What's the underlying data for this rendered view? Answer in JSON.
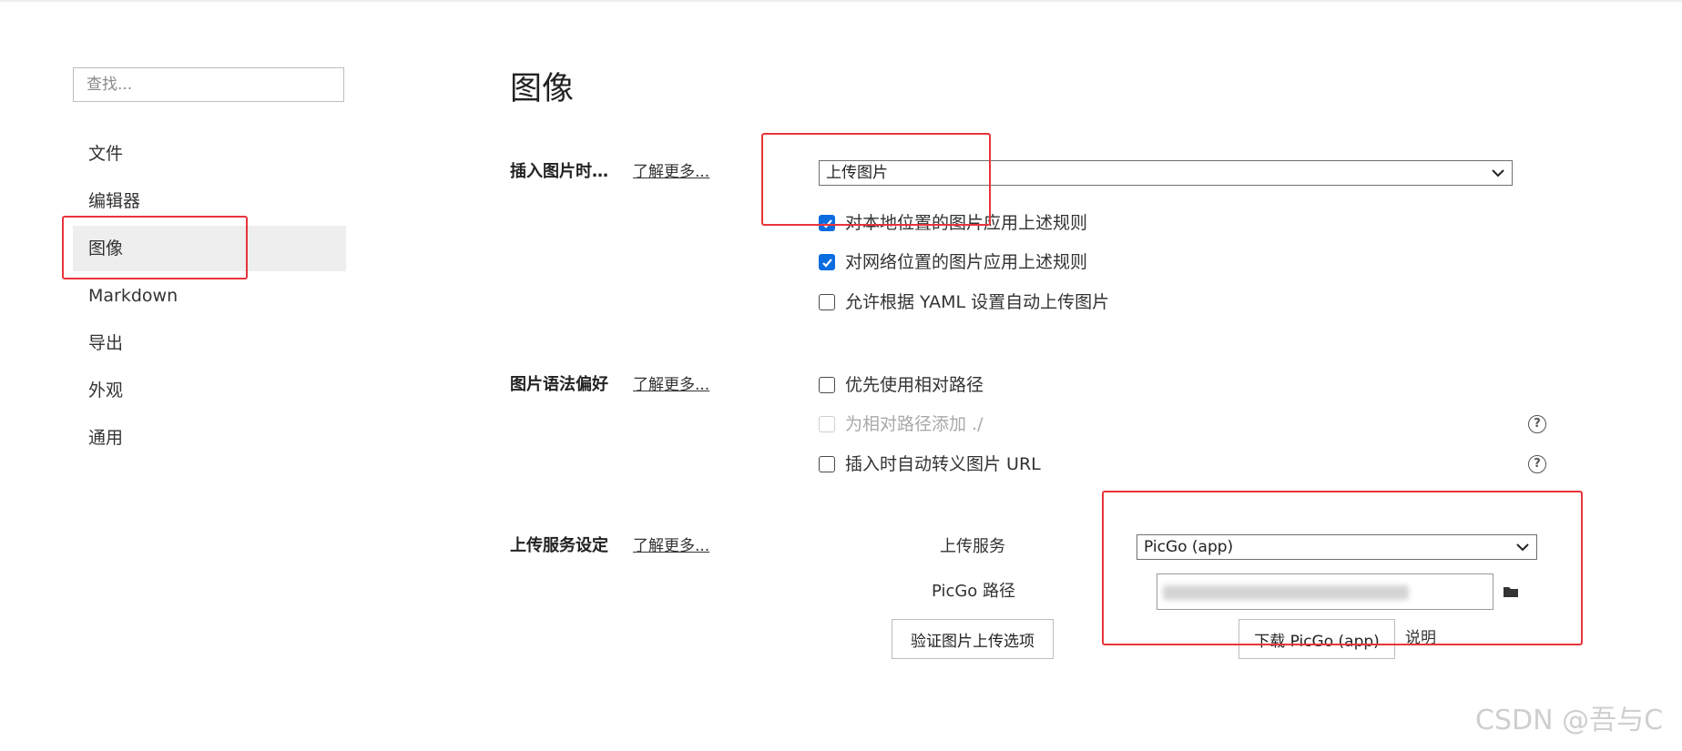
{
  "sidebar": {
    "search_placeholder": "查找...",
    "items": [
      {
        "label": "文件"
      },
      {
        "label": "编辑器"
      },
      {
        "label": "图像",
        "active": true
      },
      {
        "label": "Markdown"
      },
      {
        "label": "导出"
      },
      {
        "label": "外观"
      },
      {
        "label": "通用"
      }
    ]
  },
  "main": {
    "title": "图像",
    "insert_section": {
      "label": "插入图片时…",
      "learn_more": "了解更多...",
      "selected": "上传图片",
      "options": [
        {
          "label": "对本地位置的图片应用上述规则",
          "checked": true
        },
        {
          "label": "对网络位置的图片应用上述规则",
          "checked": true
        },
        {
          "label": "允许根据 YAML 设置自动上传图片",
          "checked": false
        }
      ]
    },
    "syntax_section": {
      "label": "图片语法偏好",
      "learn_more": "了解更多...",
      "options": [
        {
          "label": "优先使用相对路径",
          "checked": false,
          "disabled": false
        },
        {
          "label": "为相对路径添加 ./",
          "checked": false,
          "disabled": true
        },
        {
          "label": "插入时自动转义图片 URL",
          "checked": false,
          "disabled": false
        }
      ],
      "help_glyph": "?"
    },
    "upload_section": {
      "label": "上传服务设定",
      "learn_more": "了解更多...",
      "service_label": "上传服务",
      "service_selected": "PicGo (app)",
      "path_label": "PicGo 路径",
      "verify_button": "验证图片上传选项",
      "download_button": "下载 PicGo (app)",
      "doc_link": "说明"
    }
  },
  "watermark": "CSDN @吾与C",
  "colors": {
    "annotation": "#e8343b",
    "checkbox_checked": "#0b6ce0",
    "active_nav_bg": "#eeeeee"
  },
  "icons": [
    "chevron-down-icon",
    "checkmark-icon",
    "help-icon",
    "folder-icon"
  ]
}
